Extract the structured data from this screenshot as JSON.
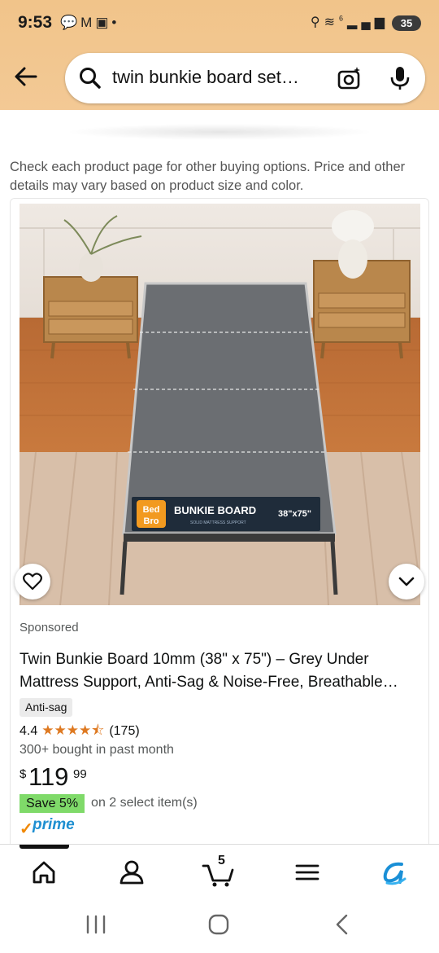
{
  "status_bar": {
    "time": "9:53",
    "left_icons": [
      "chat-icon",
      "gmail-icon",
      "screenshot-icon",
      "dot-icon"
    ],
    "right_icons": [
      "location-icon",
      "wifi-icon",
      "signal-icon"
    ],
    "wifi_label": "6",
    "battery": "35"
  },
  "search": {
    "query": "twin bunkie board set…",
    "icons": [
      "search-icon",
      "camera-icon",
      "mic-icon"
    ]
  },
  "notice": "Check each product page for other buying options. Price and other details may vary based on product size and color.",
  "product": {
    "image_alt_brand": "Bed Bro",
    "image_label": "BUNKIE BOARD",
    "image_sub": "SOLID MATTRESS SUPPORT",
    "image_size": "38\"x75\"",
    "sponsored": "Sponsored",
    "title": "Twin Bunkie Board 10mm (38\" x 75\") – Grey Under Mattress Support, Anti-Sag & Noise-Free, Breathable…",
    "badge": "Anti-sag",
    "rating": "4.4",
    "rating_value": 4.4,
    "reviews": "(175)",
    "bought": "300+ bought in past month",
    "price_currency": "$",
    "price_whole": "119",
    "price_fraction": "99",
    "save_badge": "Save 5%",
    "save_note": "on 2 select item(s)",
    "prime": "prime"
  },
  "bottom_nav": {
    "items": [
      "home",
      "account",
      "cart",
      "menu",
      "rufus"
    ],
    "cart_count": "5"
  },
  "colors": {
    "header_bg": "#f1c48a",
    "star": "#de7921",
    "save_green": "#7fda69",
    "prime_blue": "#1f8fd1",
    "prime_check": "#f08804"
  }
}
